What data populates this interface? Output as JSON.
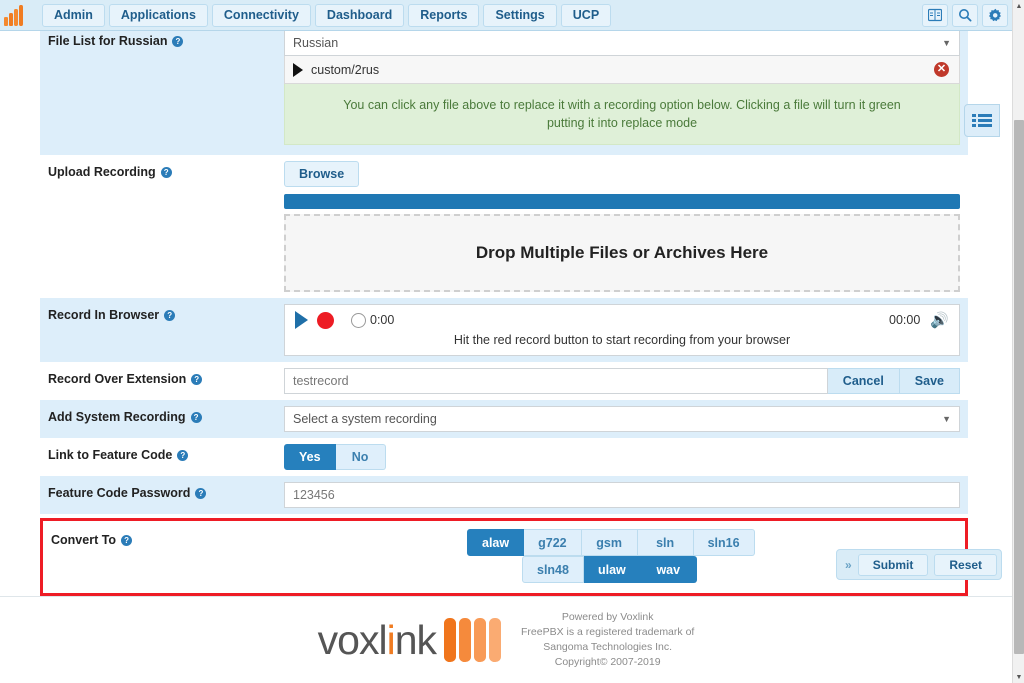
{
  "topnav": {
    "logo_name": "voxlink-logo",
    "items": [
      {
        "label": "Admin"
      },
      {
        "label": "Applications"
      },
      {
        "label": "Connectivity"
      },
      {
        "label": "Dashboard"
      },
      {
        "label": "Reports"
      },
      {
        "label": "Settings"
      },
      {
        "label": "UCP"
      }
    ],
    "icons": [
      {
        "name": "language-icon",
        "glyph": "🖺"
      },
      {
        "name": "search-icon",
        "glyph": "🔍"
      },
      {
        "name": "gear-icon",
        "glyph": "⚙"
      }
    ]
  },
  "form": {
    "file_list": {
      "label": "File List for Russian",
      "help": "?",
      "language_value": "Russian",
      "file_name": "custom/2rus",
      "delete_glyph": "✕",
      "hint": "You can click any file above to replace it with a recording option below. Clicking a file will turn it green putting it into replace mode"
    },
    "upload": {
      "label": "Upload Recording",
      "help": "?",
      "browse_label": "Browse",
      "dropzone_label": "Drop Multiple Files or Archives Here",
      "progress_percent": 100
    },
    "record_browser": {
      "label": "Record In Browser",
      "help": "?",
      "elapsed": "0:00",
      "duration": "00:00",
      "speaker_glyph": "🔊",
      "hint": "Hit the red record button to start recording from your browser"
    },
    "record_over_extension": {
      "label": "Record Over Extension",
      "help": "?",
      "value": "testrecord",
      "cancel_label": "Cancel",
      "save_label": "Save"
    },
    "add_system_recording": {
      "label": "Add System Recording",
      "help": "?",
      "placeholder": "Select a system recording"
    },
    "link_feature_code": {
      "label": "Link to Feature Code",
      "help": "?",
      "yes_label": "Yes",
      "no_label": "No",
      "selected": "Yes"
    },
    "feature_code_password": {
      "label": "Feature Code Password",
      "help": "?",
      "value": "123456"
    },
    "convert_to": {
      "label": "Convert To",
      "help": "?",
      "highlight_color": "#ee1c25",
      "row1": [
        {
          "label": "alaw",
          "selected": true
        },
        {
          "label": "g722",
          "selected": false
        },
        {
          "label": "gsm",
          "selected": false
        },
        {
          "label": "sln",
          "selected": false
        },
        {
          "label": "sln16",
          "selected": false
        }
      ],
      "row2": [
        {
          "label": "sln48",
          "selected": false
        },
        {
          "label": "ulaw",
          "selected": true
        },
        {
          "label": "wav",
          "selected": true
        }
      ]
    }
  },
  "submit_bar": {
    "chevron": "»",
    "submit_label": "Submit",
    "reset_label": "Reset"
  },
  "side_tab": {
    "name": "list-panel-icon"
  },
  "footer": {
    "brand_pre": "vox",
    "brand_i": "i",
    "brand_post": "nk",
    "brand_l": "l",
    "lines": [
      "Powered by Voxlink",
      "FreePBX is a registered trademark of",
      "Sangoma Technologies Inc.",
      "Copyright© 2007-2019"
    ]
  },
  "scrollbar": {
    "up": "▲",
    "down": "▼"
  }
}
